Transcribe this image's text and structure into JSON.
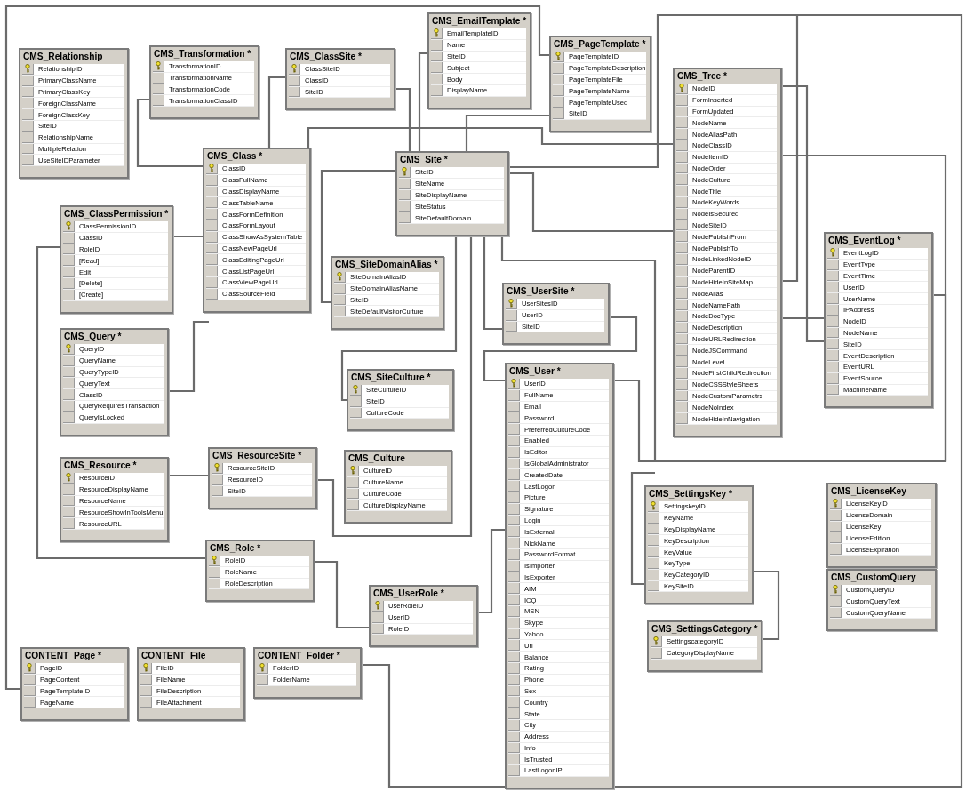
{
  "diagram": {
    "tables": [
      {
        "title": "CMS_Relationship",
        "fields": [
          {
            "name": "RelationshipID",
            "primary_key": true
          },
          {
            "name": "PrimaryClassName",
            "primary_key": false
          },
          {
            "name": "PrimaryClassKey",
            "primary_key": false
          },
          {
            "name": "ForeignClassName",
            "primary_key": false
          },
          {
            "name": "ForeignClassKey",
            "primary_key": false
          },
          {
            "name": "SiteID",
            "primary_key": false
          },
          {
            "name": "RelationshipName",
            "primary_key": false
          },
          {
            "name": "MultipleRelation",
            "primary_key": false
          },
          {
            "name": "UseSiteIDParameter",
            "primary_key": false
          }
        ]
      },
      {
        "title": "CMS_Transformation *",
        "fields": [
          {
            "name": "TransformationID",
            "primary_key": true
          },
          {
            "name": "TransformationName",
            "primary_key": false
          },
          {
            "name": "TransformationCode",
            "primary_key": false
          },
          {
            "name": "TransformationClassID",
            "primary_key": false
          }
        ]
      },
      {
        "title": "CMS_ClassSite *",
        "fields": [
          {
            "name": "ClassSiteID",
            "primary_key": true
          },
          {
            "name": "ClassID",
            "primary_key": false
          },
          {
            "name": "SiteID",
            "primary_key": false
          }
        ]
      },
      {
        "title": "CMS_EmailTemplate *",
        "fields": [
          {
            "name": "EmailTemplateID",
            "primary_key": true
          },
          {
            "name": "Name",
            "primary_key": false
          },
          {
            "name": "SiteID",
            "primary_key": false
          },
          {
            "name": "Subject",
            "primary_key": false
          },
          {
            "name": "Body",
            "primary_key": false
          },
          {
            "name": "DisplayName",
            "primary_key": false
          }
        ]
      },
      {
        "title": "CMS_PageTemplate *",
        "fields": [
          {
            "name": "PageTemplateID",
            "primary_key": true
          },
          {
            "name": "PageTemplateDescription",
            "primary_key": false
          },
          {
            "name": "PageTemplateFile",
            "primary_key": false
          },
          {
            "name": "PageTemplateName",
            "primary_key": false
          },
          {
            "name": "PageTemplateUsed",
            "primary_key": false
          },
          {
            "name": "SiteID",
            "primary_key": false
          }
        ]
      },
      {
        "title": "CMS_Tree *",
        "fields": [
          {
            "name": "NodeID",
            "primary_key": true
          },
          {
            "name": "FormInserted",
            "primary_key": false
          },
          {
            "name": "FormUpdated",
            "primary_key": false
          },
          {
            "name": "NodeName",
            "primary_key": false
          },
          {
            "name": "NodeAliasPath",
            "primary_key": false
          },
          {
            "name": "NodeClassID",
            "primary_key": false
          },
          {
            "name": "NodeItemID",
            "primary_key": false
          },
          {
            "name": "NodeOrder",
            "primary_key": false
          },
          {
            "name": "NodeCulture",
            "primary_key": false
          },
          {
            "name": "NodeTitle",
            "primary_key": false
          },
          {
            "name": "NodeKeyWords",
            "primary_key": false
          },
          {
            "name": "NodeIsSecured",
            "primary_key": false
          },
          {
            "name": "NodeSiteID",
            "primary_key": false
          },
          {
            "name": "NodePublishFrom",
            "primary_key": false
          },
          {
            "name": "NodePublishTo",
            "primary_key": false
          },
          {
            "name": "NodeLinkedNodeID",
            "primary_key": false
          },
          {
            "name": "NodeParentID",
            "primary_key": false
          },
          {
            "name": "NodeHideInSiteMap",
            "primary_key": false
          },
          {
            "name": "NodeAlias",
            "primary_key": false
          },
          {
            "name": "NodeNamePath",
            "primary_key": false
          },
          {
            "name": "NodeDocType",
            "primary_key": false
          },
          {
            "name": "NodeDescription",
            "primary_key": false
          },
          {
            "name": "NodeURLRedirection",
            "primary_key": false
          },
          {
            "name": "NodeJSCommand",
            "primary_key": false
          },
          {
            "name": "NodeLevel",
            "primary_key": false
          },
          {
            "name": "NodeFirstChildRedirection",
            "primary_key": false
          },
          {
            "name": "NodeCSSStyleSheets",
            "primary_key": false
          },
          {
            "name": "NodeCustomParametrs",
            "primary_key": false
          },
          {
            "name": "NodeNoIndex",
            "primary_key": false
          },
          {
            "name": "NodeHideInNavigation",
            "primary_key": false
          }
        ]
      },
      {
        "title": "CMS_Class *",
        "fields": [
          {
            "name": "ClassID",
            "primary_key": true
          },
          {
            "name": "ClassFullName",
            "primary_key": false
          },
          {
            "name": "ClassDisplayName",
            "primary_key": false
          },
          {
            "name": "ClassTableName",
            "primary_key": false
          },
          {
            "name": "ClassFormDefinition",
            "primary_key": false
          },
          {
            "name": "ClassFormLayout",
            "primary_key": false
          },
          {
            "name": "ClassShowAsSystemTable",
            "primary_key": false
          },
          {
            "name": "ClassNewPageUrl",
            "primary_key": false
          },
          {
            "name": "ClassEditingPageUrl",
            "primary_key": false
          },
          {
            "name": "ClassListPageUrl",
            "primary_key": false
          },
          {
            "name": "ClassViewPageUrl",
            "primary_key": false
          },
          {
            "name": "ClassSourceField",
            "primary_key": false
          }
        ]
      },
      {
        "title": "CMS_Site *",
        "fields": [
          {
            "name": "SiteID",
            "primary_key": true
          },
          {
            "name": "SiteName",
            "primary_key": false
          },
          {
            "name": "SiteDisplayName",
            "primary_key": false
          },
          {
            "name": "SiteStatus",
            "primary_key": false
          },
          {
            "name": "SiteDefaultDomain",
            "primary_key": false
          }
        ]
      },
      {
        "title": "CMS_ClassPermission *",
        "fields": [
          {
            "name": "ClassPermissionID",
            "primary_key": true
          },
          {
            "name": "ClassID",
            "primary_key": false
          },
          {
            "name": "RoleID",
            "primary_key": false
          },
          {
            "name": "[Read]",
            "primary_key": false
          },
          {
            "name": "Edit",
            "primary_key": false
          },
          {
            "name": "[Delete]",
            "primary_key": false
          },
          {
            "name": "[Create]",
            "primary_key": false
          }
        ]
      },
      {
        "title": "CMS_SiteDomainAlias *",
        "fields": [
          {
            "name": "SiteDomainAliasID",
            "primary_key": true
          },
          {
            "name": "SiteDomainAliasName",
            "primary_key": false
          },
          {
            "name": "SiteID",
            "primary_key": false
          },
          {
            "name": "SiteDefaultVisitorCulture",
            "primary_key": false
          }
        ]
      },
      {
        "title": "CMS_UserSite *",
        "fields": [
          {
            "name": "UserSitesID",
            "primary_key": true
          },
          {
            "name": "UserID",
            "primary_key": false
          },
          {
            "name": "SiteID",
            "primary_key": false
          }
        ]
      },
      {
        "title": "CMS_EventLog *",
        "fields": [
          {
            "name": "EventLogID",
            "primary_key": true
          },
          {
            "name": "EventType",
            "primary_key": false
          },
          {
            "name": "EventTime",
            "primary_key": false
          },
          {
            "name": "UserID",
            "primary_key": false
          },
          {
            "name": "UserName",
            "primary_key": false
          },
          {
            "name": "IPAddress",
            "primary_key": false
          },
          {
            "name": "NodeID",
            "primary_key": false
          },
          {
            "name": "NodeName",
            "primary_key": false
          },
          {
            "name": "SiteID",
            "primary_key": false
          },
          {
            "name": "EventDescription",
            "primary_key": false
          },
          {
            "name": "EventURL",
            "primary_key": false
          },
          {
            "name": "EventSource",
            "primary_key": false
          },
          {
            "name": "MachineName",
            "primary_key": false
          }
        ]
      },
      {
        "title": "CMS_Query *",
        "fields": [
          {
            "name": "QueryID",
            "primary_key": true
          },
          {
            "name": "QueryName",
            "primary_key": false
          },
          {
            "name": "QueryTypeID",
            "primary_key": false
          },
          {
            "name": "QueryText",
            "primary_key": false
          },
          {
            "name": "ClassID",
            "primary_key": false
          },
          {
            "name": "QueryRequiresTransaction",
            "primary_key": false
          },
          {
            "name": "QueryIsLocked",
            "primary_key": false
          }
        ]
      },
      {
        "title": "CMS_SiteCulture *",
        "fields": [
          {
            "name": "SiteCultureID",
            "primary_key": true
          },
          {
            "name": "SiteID",
            "primary_key": false
          },
          {
            "name": "CultureCode",
            "primary_key": false
          }
        ]
      },
      {
        "title": "CMS_User *",
        "fields": [
          {
            "name": "UserID",
            "primary_key": true
          },
          {
            "name": "FullName",
            "primary_key": false
          },
          {
            "name": "Email",
            "primary_key": false
          },
          {
            "name": "Password",
            "primary_key": false
          },
          {
            "name": "PreferredCultureCode",
            "primary_key": false
          },
          {
            "name": "Enabled",
            "primary_key": false
          },
          {
            "name": "IsEditor",
            "primary_key": false
          },
          {
            "name": "IsGlobalAdministrator",
            "primary_key": false
          },
          {
            "name": "CreatedDate",
            "primary_key": false
          },
          {
            "name": "LastLogon",
            "primary_key": false
          },
          {
            "name": "Picture",
            "primary_key": false
          },
          {
            "name": "Signature",
            "primary_key": false
          },
          {
            "name": "Login",
            "primary_key": false
          },
          {
            "name": "IsExternal",
            "primary_key": false
          },
          {
            "name": "NickName",
            "primary_key": false
          },
          {
            "name": "PasswordFormat",
            "primary_key": false
          },
          {
            "name": "IsImporter",
            "primary_key": false
          },
          {
            "name": "IsExporter",
            "primary_key": false
          },
          {
            "name": "AIM",
            "primary_key": false
          },
          {
            "name": "ICQ",
            "primary_key": false
          },
          {
            "name": "MSN",
            "primary_key": false
          },
          {
            "name": "Skype",
            "primary_key": false
          },
          {
            "name": "Yahoo",
            "primary_key": false
          },
          {
            "name": "Url",
            "primary_key": false
          },
          {
            "name": "Balance",
            "primary_key": false
          },
          {
            "name": "Rating",
            "primary_key": false
          },
          {
            "name": "Phone",
            "primary_key": false
          },
          {
            "name": "Sex",
            "primary_key": false
          },
          {
            "name": "Country",
            "primary_key": false
          },
          {
            "name": "State",
            "primary_key": false
          },
          {
            "name": "City",
            "primary_key": false
          },
          {
            "name": "Address",
            "primary_key": false
          },
          {
            "name": "Info",
            "primary_key": false
          },
          {
            "name": "IsTrusted",
            "primary_key": false
          },
          {
            "name": "LastLogonIP",
            "primary_key": false
          }
        ]
      },
      {
        "title": "CMS_Resource *",
        "fields": [
          {
            "name": "ResourceID",
            "primary_key": true
          },
          {
            "name": "ResourceDisplayName",
            "primary_key": false
          },
          {
            "name": "ResourceName",
            "primary_key": false
          },
          {
            "name": "ResourceShowInToolsMenu",
            "primary_key": false
          },
          {
            "name": "ResourceURL",
            "primary_key": false
          }
        ]
      },
      {
        "title": "CMS_ResourceSite *",
        "fields": [
          {
            "name": "ResourceSiteID",
            "primary_key": true
          },
          {
            "name": "ResourceID",
            "primary_key": false
          },
          {
            "name": "SiteID",
            "primary_key": false
          }
        ]
      },
      {
        "title": "CMS_Culture",
        "fields": [
          {
            "name": "CultureID",
            "primary_key": true
          },
          {
            "name": "CultureName",
            "primary_key": false
          },
          {
            "name": "CultureCode",
            "primary_key": false
          },
          {
            "name": "CultureDisplayName",
            "primary_key": false
          }
        ]
      },
      {
        "title": "CMS_SettingsKey *",
        "fields": [
          {
            "name": "SettingskeyID",
            "primary_key": true
          },
          {
            "name": "KeyName",
            "primary_key": false
          },
          {
            "name": "KeyDisplayName",
            "primary_key": false
          },
          {
            "name": "KeyDescription",
            "primary_key": false
          },
          {
            "name": "KeyValue",
            "primary_key": false
          },
          {
            "name": "KeyType",
            "primary_key": false
          },
          {
            "name": "KeyCategoryID",
            "primary_key": false
          },
          {
            "name": "KeySiteID",
            "primary_key": false
          }
        ]
      },
      {
        "title": "CMS_LicenseKey",
        "fields": [
          {
            "name": "LicenseKeyID",
            "primary_key": true
          },
          {
            "name": "LicenseDomain",
            "primary_key": false
          },
          {
            "name": "LicenseKey",
            "primary_key": false
          },
          {
            "name": "LicenseEdition",
            "primary_key": false
          },
          {
            "name": "LicenseExpiration",
            "primary_key": false
          }
        ]
      },
      {
        "title": "CMS_Role *",
        "fields": [
          {
            "name": "RoleID",
            "primary_key": true
          },
          {
            "name": "RoleName",
            "primary_key": false
          },
          {
            "name": "RoleDescription",
            "primary_key": false
          }
        ]
      },
      {
        "title": "CMS_UserRole *",
        "fields": [
          {
            "name": "UserRoleID",
            "primary_key": true
          },
          {
            "name": "UserID",
            "primary_key": false
          },
          {
            "name": "RoleID",
            "primary_key": false
          }
        ]
      },
      {
        "title": "CMS_CustomQuery",
        "fields": [
          {
            "name": "CustomQueryID",
            "primary_key": true
          },
          {
            "name": "CustomQueryText",
            "primary_key": false
          },
          {
            "name": "CustomQueryName",
            "primary_key": false
          }
        ]
      },
      {
        "title": "CMS_SettingsCategory *",
        "fields": [
          {
            "name": "SettingscategoryID",
            "primary_key": true
          },
          {
            "name": "CategoryDisplayName",
            "primary_key": false
          }
        ]
      },
      {
        "title": "CONTENT_Page *",
        "fields": [
          {
            "name": "PageID",
            "primary_key": true
          },
          {
            "name": "PageContent",
            "primary_key": false
          },
          {
            "name": "PageTemplateID",
            "primary_key": false
          },
          {
            "name": "PageName",
            "primary_key": false
          }
        ]
      },
      {
        "title": "CONTENT_File",
        "fields": [
          {
            "name": "FileID",
            "primary_key": true
          },
          {
            "name": "FileName",
            "primary_key": false
          },
          {
            "name": "FileDescription",
            "primary_key": false
          },
          {
            "name": "FileAttachment",
            "primary_key": false
          }
        ]
      },
      {
        "title": "CONTENT_Folder *",
        "fields": [
          {
            "name": "FolderID",
            "primary_key": true
          },
          {
            "name": "FolderName",
            "primary_key": false
          }
        ]
      }
    ]
  }
}
